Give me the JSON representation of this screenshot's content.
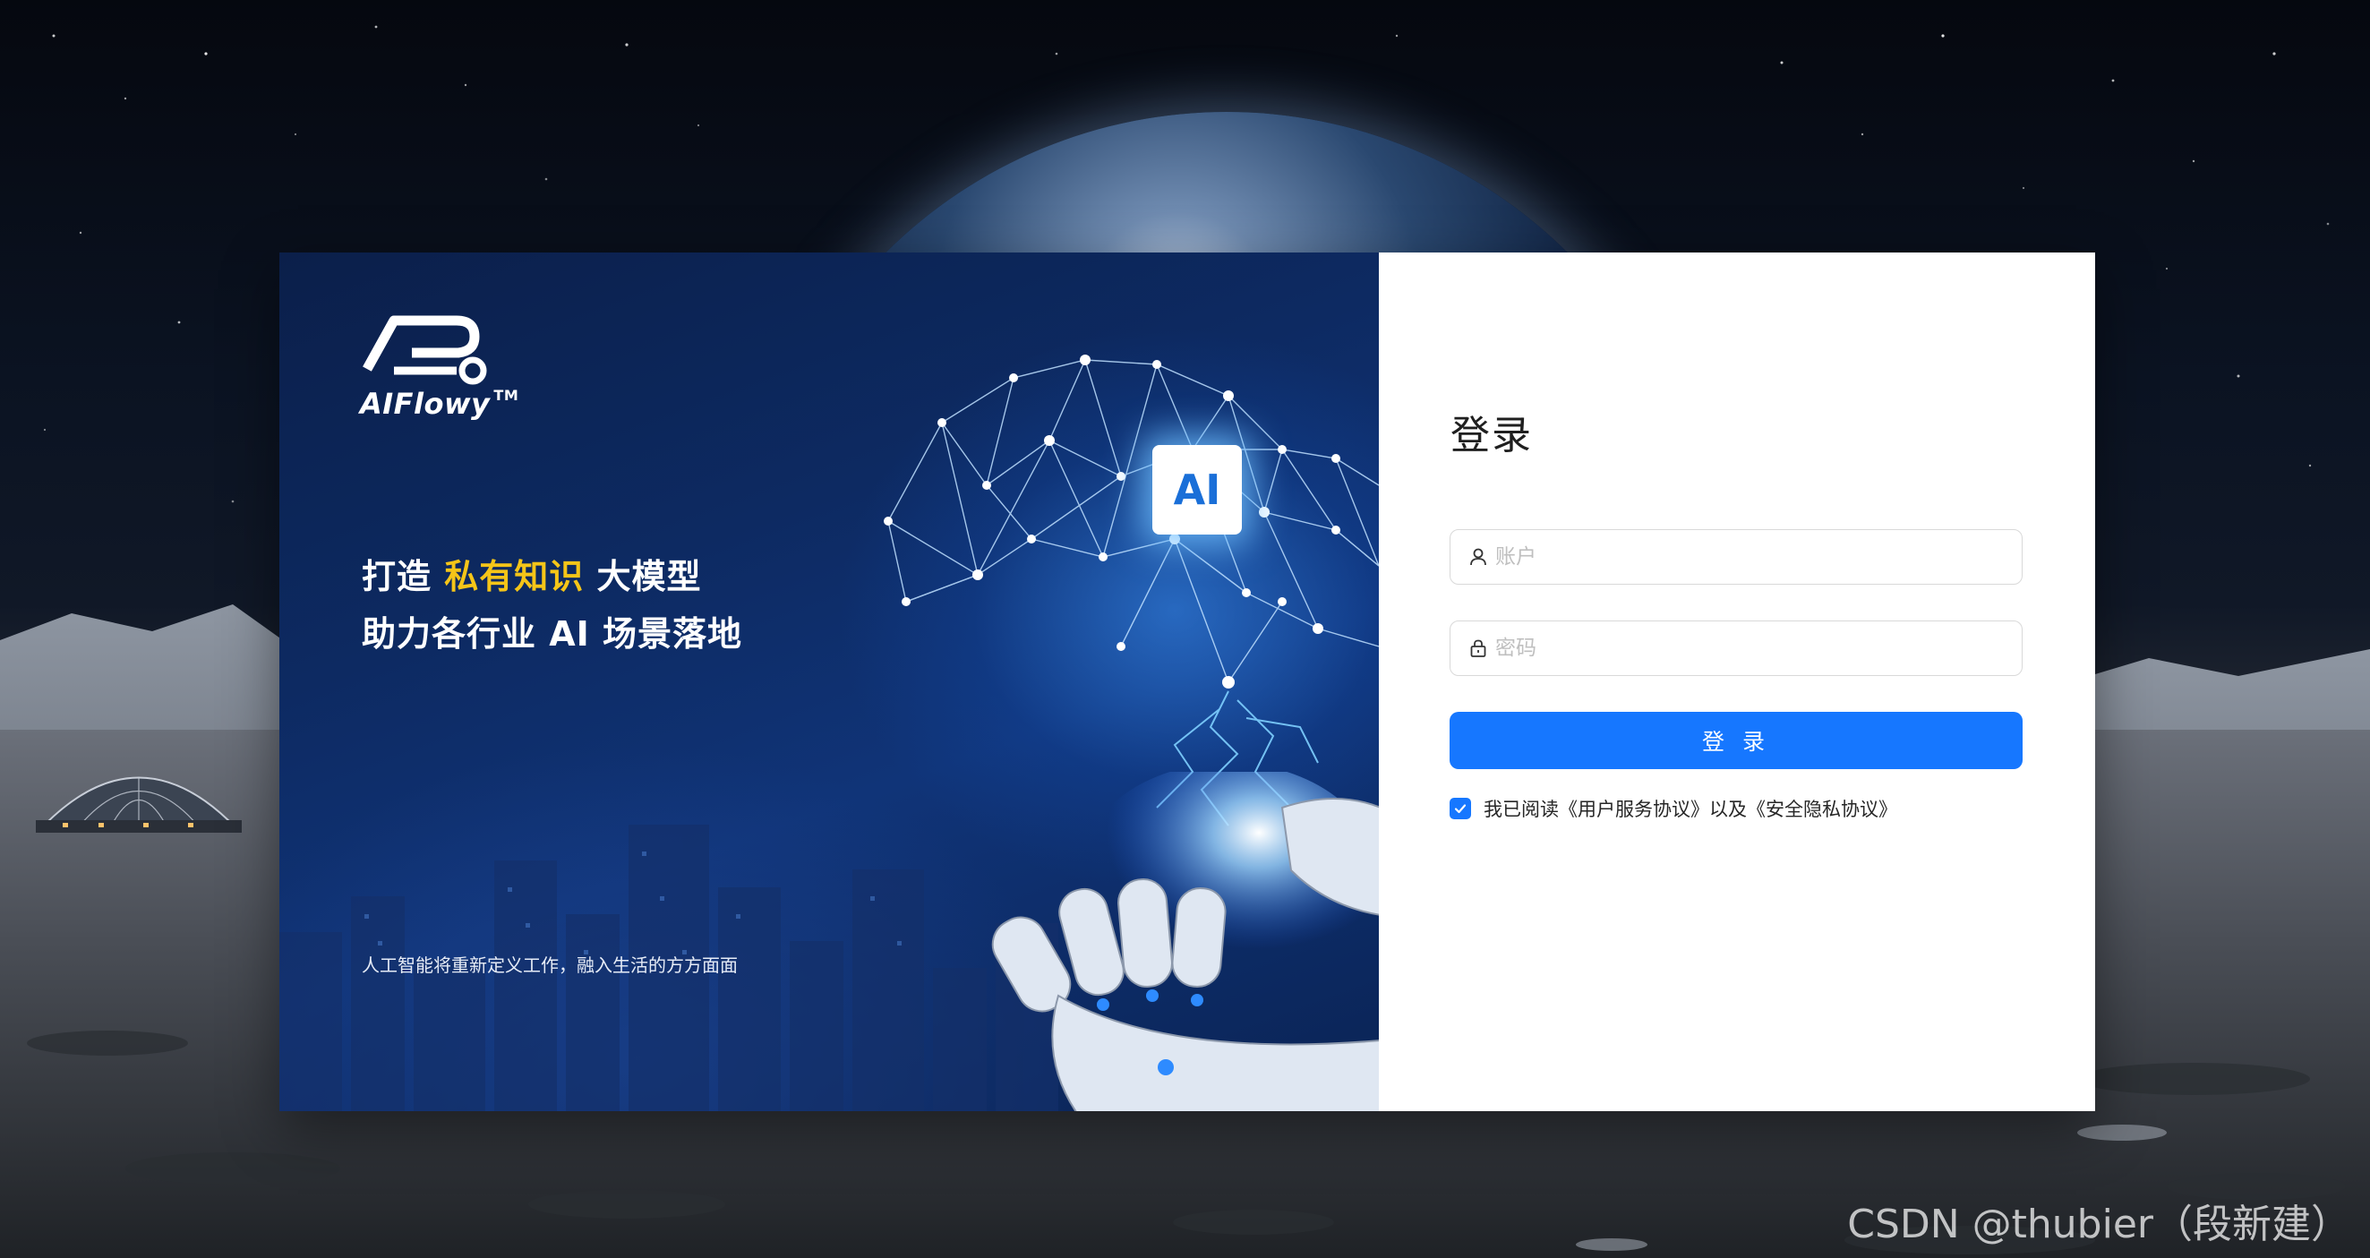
{
  "brand": {
    "name": "AIFlowy",
    "trademark": "TM"
  },
  "left_panel": {
    "slogan_line1_pre": "打造 ",
    "slogan_line1_highlight": "私有知识",
    "slogan_line1_post": " 大模型",
    "slogan_line2": "助力各行业 AI 场景落地",
    "chip_label": "AI",
    "tagline": "人工智能将重新定义工作，融入生活的方方面面"
  },
  "login": {
    "title": "登录",
    "account_placeholder": "账户",
    "account_value": "",
    "password_placeholder": "密码",
    "password_value": "",
    "submit_label": "登 录",
    "agreement_text": "我已阅读《用户服务协议》以及《安全隐私协议》",
    "agreement_checked": true
  },
  "icons": {
    "account": "user-icon",
    "password": "lock-icon",
    "checkbox": "check-icon"
  },
  "colors": {
    "primary": "#1677ff",
    "highlight": "#f5c518",
    "panel_bg": "#0d2a62"
  },
  "watermark": "CSDN @thubier（段新建）"
}
